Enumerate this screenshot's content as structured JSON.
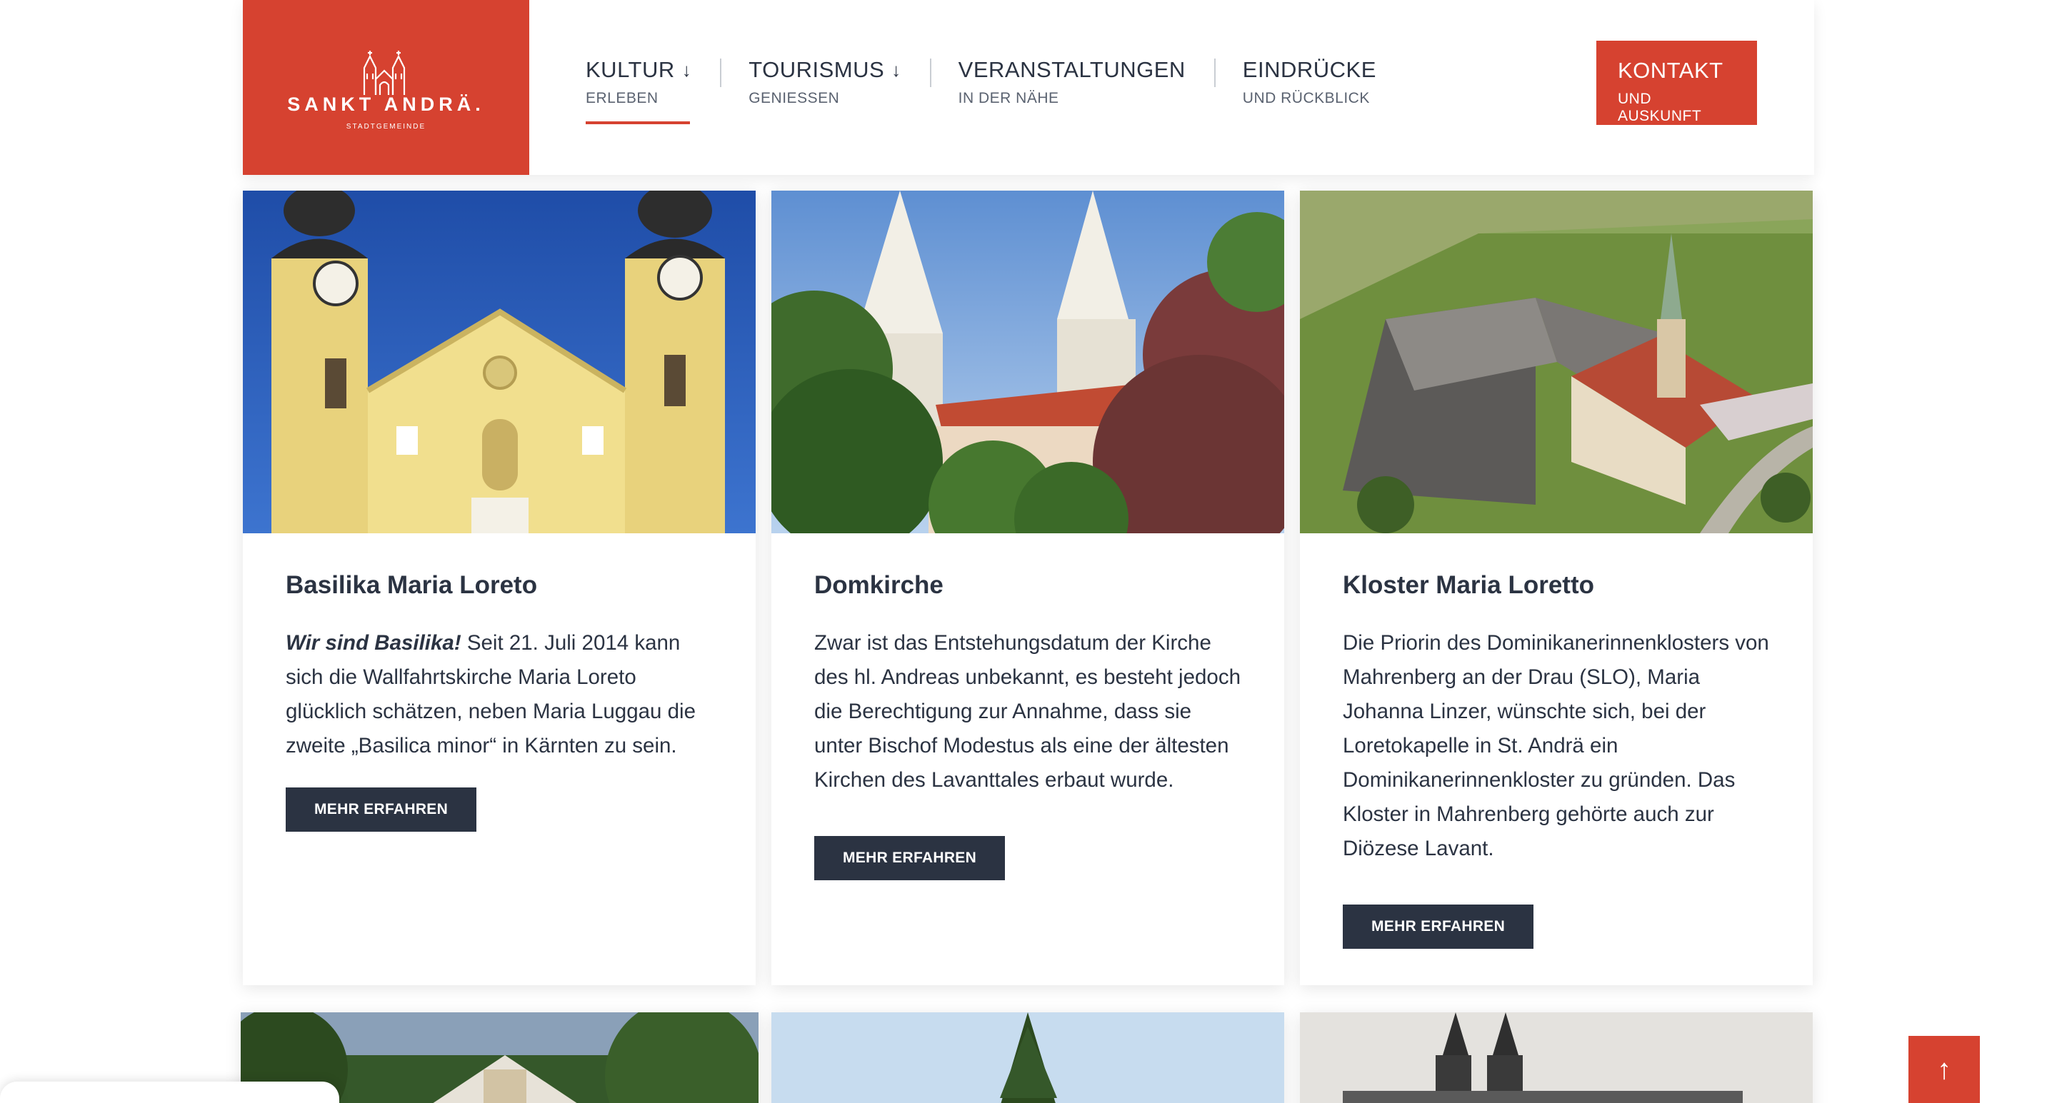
{
  "logo": {
    "name": "SANKT ANDRÄ.",
    "tagline": "STADTGEMEINDE"
  },
  "nav": {
    "items": [
      {
        "label": "KULTUR",
        "sub": "ERLEBEN",
        "arrow": "↓",
        "active": true
      },
      {
        "label": "TOURISMUS",
        "sub": "GENIESSEN",
        "arrow": "↓"
      },
      {
        "label": "VERANSTALTUNGEN",
        "sub": "IN DER NÄHE"
      },
      {
        "label": "EINDRÜCKE",
        "sub": "UND RÜCKBLICK"
      }
    ],
    "contact": {
      "label": "KONTAKT",
      "sub": "UND AUSKUNFT"
    }
  },
  "cards": [
    {
      "title": "Basilika Maria Loreto",
      "text_em": "Wir sind Basilika!",
      "text": " Seit 21. Juli 2014 kann sich die Wallfahrtskirche Maria Loreto glücklich schätzen, neben Maria Luggau die zweite „Basilica minor“ in Kärnten zu sein.",
      "button": "MEHR ERFAHREN"
    },
    {
      "title": "Domkirche",
      "text": "Zwar ist das Entstehungsdatum der Kirche des hl. Andreas unbekannt, es besteht jedoch die Berechtigung zur Annahme, dass sie unter Bischof Modestus als eine der ältesten Kirchen des Lavanttales erbaut wurde.",
      "button": "MEHR ERFAHREN"
    },
    {
      "title": "Kloster Maria Loretto",
      "text": "Die Priorin des Dominikanerinnenklosters von Mahrenberg an der Drau (SLO), Maria Johanna Linzer, wünschte sich, bei der Loretokapelle in St. Andrä ein Dominikanerinnenkloster zu gründen. Das Kloster in Mahrenberg gehörte auch zur Diözese Lavant.",
      "button": "MEHR ERFAHREN"
    }
  ],
  "scroll_top": {
    "icon": "↑"
  },
  "colors": {
    "brand_red": "#d64230",
    "dark_navy": "#2b3342"
  }
}
